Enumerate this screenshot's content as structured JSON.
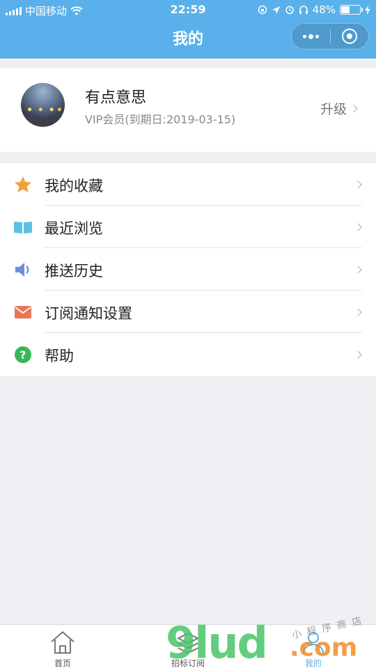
{
  "status_bar": {
    "carrier": "中国移动",
    "time": "22:59",
    "battery": "48%",
    "battery_level": 0.48
  },
  "nav": {
    "title": "我的"
  },
  "profile": {
    "name": "有点意思",
    "vip": "VIP会员(到期日:2019-03-15)",
    "upgrade_label": "升级"
  },
  "menu": [
    {
      "label": "我的收藏",
      "icon": "star-icon",
      "color": "#f0a23a"
    },
    {
      "label": "最近浏览",
      "icon": "book-icon",
      "color": "#5bc0e8"
    },
    {
      "label": "推送历史",
      "icon": "speaker-icon",
      "color": "#6a8fd8"
    },
    {
      "label": "订阅通知设置",
      "icon": "mail-icon",
      "color": "#e8775a"
    },
    {
      "label": "帮助",
      "icon": "help-icon",
      "color": "#3cb55a"
    }
  ],
  "tabs": [
    {
      "label": "首页",
      "icon": "home-icon"
    },
    {
      "label": "招标订阅",
      "icon": "layers-icon"
    },
    {
      "label": "我的",
      "icon": "user-icon"
    }
  ],
  "watermark": {
    "main": "9lud",
    "suffix": ".com",
    "small": "小程序商店"
  },
  "colors": {
    "nav_background": "#59b0ea",
    "page_background": "#efeff4"
  }
}
